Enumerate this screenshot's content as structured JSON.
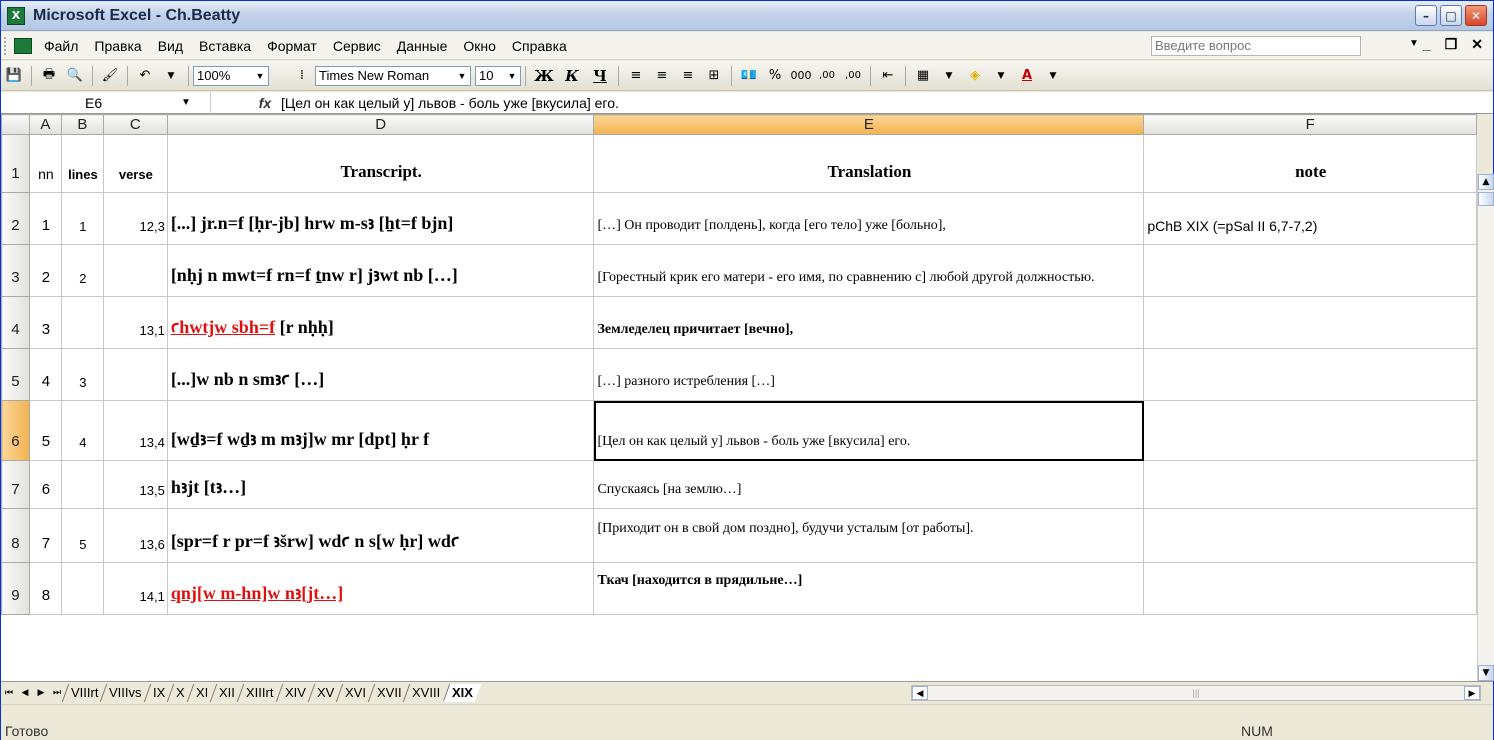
{
  "window": {
    "title": "Microsoft Excel - Ch.Beatty",
    "app_icon": "X"
  },
  "menu": {
    "items": [
      "Файл",
      "Правка",
      "Вид",
      "Вставка",
      "Формат",
      "Сервис",
      "Данные",
      "Окно",
      "Справка"
    ],
    "ask_placeholder": "Введите вопрос"
  },
  "toolbar": {
    "zoom": "100%",
    "font": "Times New Roman",
    "size": "10",
    "bold": "Ж",
    "italic": "К",
    "underline": "Ч",
    "percent": "%",
    "thousands": "000",
    "inc_dec": ",00",
    "dec_dec": ",00"
  },
  "formula_bar": {
    "cell_ref": "E6",
    "fx": "fx",
    "content": "[Цел он как целый у] львов - боль уже [вкусила] его."
  },
  "columns": [
    "A",
    "B",
    "C",
    "D",
    "E",
    "F"
  ],
  "header_row": {
    "row": "1",
    "a": "nn",
    "b": "lines",
    "c": "verse",
    "d": "Transcript.",
    "e": "Translation",
    "f": "note"
  },
  "rows": [
    {
      "row": "2",
      "a": "1",
      "b": "1",
      "c": "12,3",
      "d": "[...] jr.n=f [ḥr-jb] hrw m-sꜣ [ẖt=f bjn]",
      "e": "[…] Он проводит [полдень], когда [его тело] уже [больно],",
      "f": "pChB XIX (=pSal II 6,7-7,2)"
    },
    {
      "row": "3",
      "a": "2",
      "b": "2",
      "c": "",
      "d": "[nḥj n mwt=f rn=f ṯnw r] jꜣwt nb […]",
      "e": "[Горестный крик его матери - его имя, по сравнению с] любой другой должностью.",
      "f": ""
    },
    {
      "row": "4",
      "a": "3",
      "b": "",
      "c": "13,1",
      "d_red": "ꜥhwtjw sbh=f",
      "d": " [r nḥḥ]",
      "e": "Земледелец причитает [вечно],",
      "f": ""
    },
    {
      "row": "5",
      "a": "4",
      "b": "3",
      "c": "",
      "d": "[...]w nb n smꜣꜥ […]",
      "e": "[…] разного истребления […]",
      "f": ""
    },
    {
      "row": "6",
      "a": "5",
      "b": "4",
      "c": "13,4",
      "d": "[wḏꜣ=f wḏꜣ m mꜣj]w mr [dpt] ḥr f",
      "e": "[Цел он как целый у] львов - боль уже [вкусила] его.",
      "f": ""
    },
    {
      "row": "7",
      "a": "6",
      "b": "",
      "c": "13,5",
      "d": "hꜣjt [tꜣ…]",
      "e": "Спускаясь [на землю…]",
      "f": ""
    },
    {
      "row": "8",
      "a": "7",
      "b": "5",
      "c": "13,6",
      "d": "[spr=f r pr=f ꜣšrw] wdꜥ n s[w ḥr] wdꜥ",
      "e": "[Приходит он в свой дом поздно], будучи усталым [от работы].",
      "f": ""
    },
    {
      "row": "9",
      "a": "8",
      "b": "",
      "c": "14,1",
      "d_red": "qnj[w m-hn]w nꜣ[jt…]",
      "d": "",
      "e": "Ткач [находится в прядильне…]",
      "f": ""
    }
  ],
  "sheet_tabs": [
    "VIIIrt",
    "VIIIvs",
    "IX",
    "X",
    "XI",
    "XII",
    "XIIIrt",
    "XIV",
    "XV",
    "XVI",
    "XVII",
    "XVIII",
    "XIX"
  ],
  "active_tab": "XIX",
  "status": {
    "ready": "Готово",
    "num": "NUM"
  }
}
